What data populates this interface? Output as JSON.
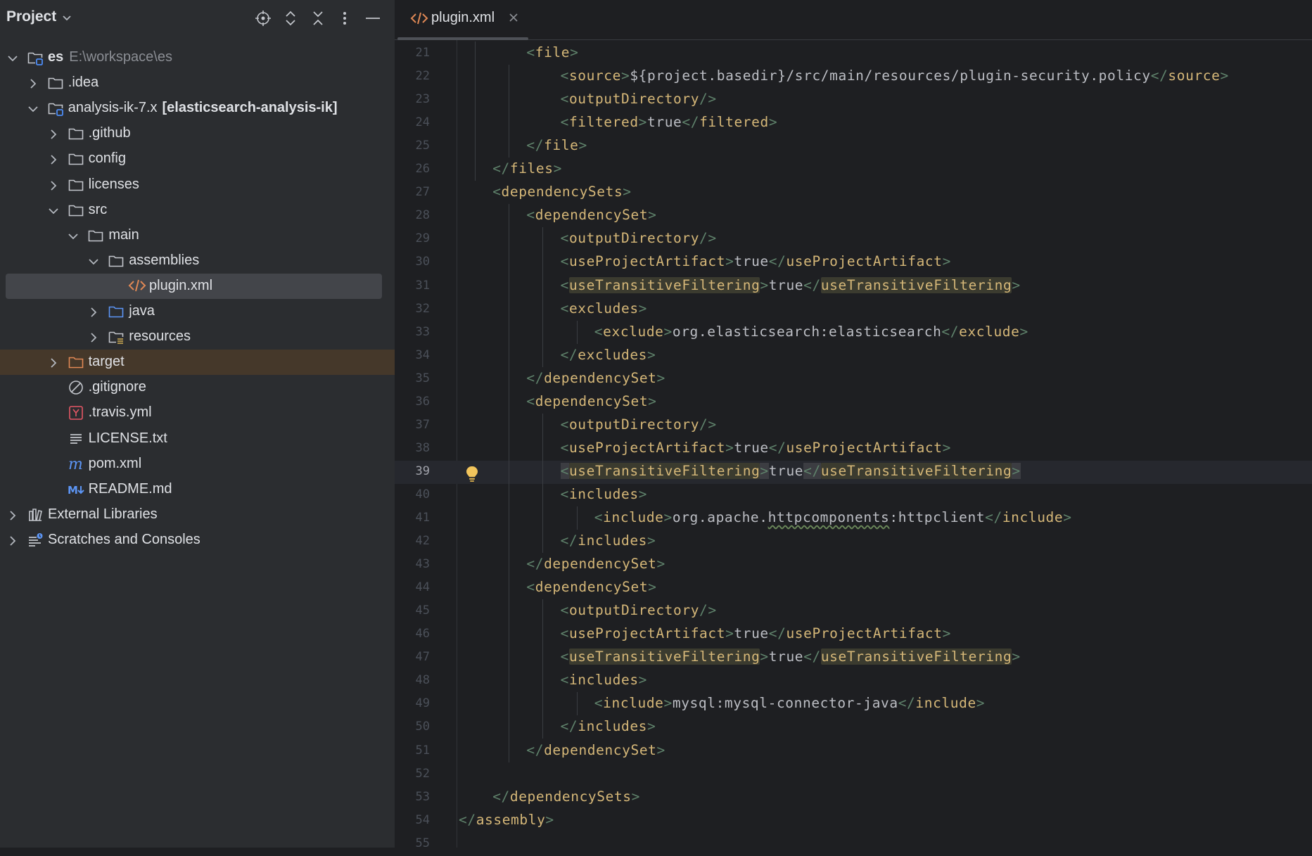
{
  "project_panel": {
    "title": "Project",
    "tree": [
      {
        "label": "es",
        "bold": true,
        "path": "E:\\workspace\\es",
        "icon": "module-folder-icon",
        "arrow": "expanded",
        "depth": 0
      },
      {
        "label": ".idea",
        "icon": "folder-icon",
        "arrow": "collapsed",
        "depth": 1
      },
      {
        "label": "analysis-ik-7.x",
        "suffix": "[elasticsearch-analysis-ik]",
        "icon": "module-folder-icon",
        "arrow": "expanded",
        "depth": 1
      },
      {
        "label": ".github",
        "icon": "folder-icon",
        "arrow": "collapsed",
        "depth": 2
      },
      {
        "label": "config",
        "icon": "folder-icon",
        "arrow": "collapsed",
        "depth": 2
      },
      {
        "label": "licenses",
        "icon": "folder-icon",
        "arrow": "collapsed",
        "depth": 2
      },
      {
        "label": "src",
        "icon": "folder-icon",
        "arrow": "expanded",
        "depth": 2
      },
      {
        "label": "main",
        "icon": "folder-icon",
        "arrow": "expanded",
        "depth": 3
      },
      {
        "label": "assemblies",
        "icon": "folder-icon",
        "arrow": "expanded",
        "depth": 4
      },
      {
        "label": "plugin.xml",
        "icon": "xml-file-icon",
        "arrow": "none",
        "depth": 5,
        "selected": true
      },
      {
        "label": "java",
        "icon": "source-folder-icon",
        "arrow": "collapsed",
        "depth": 4
      },
      {
        "label": "resources",
        "icon": "resources-folder-icon",
        "arrow": "collapsed",
        "depth": 4
      },
      {
        "label": "target",
        "icon": "excluded-folder-icon",
        "arrow": "collapsed",
        "depth": 2,
        "excluded": true
      },
      {
        "label": ".gitignore",
        "icon": "ignore-file-icon",
        "arrow": "none",
        "depth": 2
      },
      {
        "label": ".travis.yml",
        "icon": "yaml-file-icon",
        "arrow": "none",
        "depth": 2
      },
      {
        "label": "LICENSE.txt",
        "icon": "text-file-icon",
        "arrow": "none",
        "depth": 2
      },
      {
        "label": "pom.xml",
        "icon": "maven-file-icon",
        "arrow": "none",
        "depth": 2
      },
      {
        "label": "README.md",
        "icon": "markdown-file-icon",
        "arrow": "none",
        "depth": 2
      },
      {
        "label": "External Libraries",
        "icon": "libraries-icon",
        "arrow": "collapsed",
        "depth": 0
      },
      {
        "label": "Scratches and Consoles",
        "icon": "scratches-icon",
        "arrow": "collapsed",
        "depth": 0
      }
    ]
  },
  "editor": {
    "tab_label": "plugin.xml",
    "current_line": "39",
    "lines": [
      {
        "n": "21",
        "indent": 2,
        "parts": [
          [
            "br",
            "<"
          ],
          [
            "tag",
            "file"
          ],
          [
            "br",
            ">"
          ]
        ]
      },
      {
        "n": "22",
        "indent": 3,
        "parts": [
          [
            "br",
            "<"
          ],
          [
            "tag",
            "source"
          ],
          [
            "br",
            ">"
          ],
          [
            "txt",
            "${project.basedir}/src/main/resources/plugin-security.policy"
          ],
          [
            "br",
            "</"
          ],
          [
            "tag",
            "source"
          ],
          [
            "br",
            ">"
          ]
        ]
      },
      {
        "n": "23",
        "indent": 3,
        "parts": [
          [
            "br",
            "<"
          ],
          [
            "tag",
            "outputDirectory"
          ],
          [
            "br",
            "/>"
          ]
        ]
      },
      {
        "n": "24",
        "indent": 3,
        "parts": [
          [
            "br",
            "<"
          ],
          [
            "tag",
            "filtered"
          ],
          [
            "br",
            ">"
          ],
          [
            "txt",
            "true"
          ],
          [
            "br",
            "</"
          ],
          [
            "tag",
            "filtered"
          ],
          [
            "br",
            ">"
          ]
        ]
      },
      {
        "n": "25",
        "indent": 2,
        "parts": [
          [
            "br",
            "</"
          ],
          [
            "tag",
            "file"
          ],
          [
            "br",
            ">"
          ]
        ]
      },
      {
        "n": "26",
        "indent": 1,
        "parts": [
          [
            "br",
            "</"
          ],
          [
            "tag",
            "files"
          ],
          [
            "br",
            ">"
          ]
        ]
      },
      {
        "n": "27",
        "indent": 1,
        "parts": [
          [
            "br",
            "<"
          ],
          [
            "tag",
            "dependencySets"
          ],
          [
            "br",
            ">"
          ]
        ]
      },
      {
        "n": "28",
        "indent": 2,
        "parts": [
          [
            "br",
            "<"
          ],
          [
            "tag",
            "dependencySet"
          ],
          [
            "br",
            ">"
          ]
        ]
      },
      {
        "n": "29",
        "indent": 3,
        "parts": [
          [
            "br",
            "<"
          ],
          [
            "tag",
            "outputDirectory"
          ],
          [
            "br",
            "/>"
          ]
        ]
      },
      {
        "n": "30",
        "indent": 3,
        "parts": [
          [
            "br",
            "<"
          ],
          [
            "tag",
            "useProjectArtifact"
          ],
          [
            "br",
            ">"
          ],
          [
            "txt",
            "true"
          ],
          [
            "br",
            "</"
          ],
          [
            "tag",
            "useProjectArtifact"
          ],
          [
            "br",
            ">"
          ]
        ]
      },
      {
        "n": "31",
        "indent": 3,
        "parts": [
          [
            "br",
            "<"
          ],
          [
            "tagh",
            "useTransitiveFiltering"
          ],
          [
            "br",
            ">"
          ],
          [
            "txt",
            "true"
          ],
          [
            "br",
            "</"
          ],
          [
            "tagh",
            "useTransitiveFiltering"
          ],
          [
            "br",
            ">"
          ]
        ]
      },
      {
        "n": "32",
        "indent": 3,
        "parts": [
          [
            "br",
            "<"
          ],
          [
            "tag",
            "excludes"
          ],
          [
            "br",
            ">"
          ]
        ]
      },
      {
        "n": "33",
        "indent": 4,
        "parts": [
          [
            "br",
            "<"
          ],
          [
            "tag",
            "exclude"
          ],
          [
            "br",
            ">"
          ],
          [
            "txt",
            "org.elasticsearch:elasticsearch"
          ],
          [
            "br",
            "</"
          ],
          [
            "tag",
            "exclude"
          ],
          [
            "br",
            ">"
          ]
        ]
      },
      {
        "n": "34",
        "indent": 3,
        "parts": [
          [
            "br",
            "</"
          ],
          [
            "tag",
            "excludes"
          ],
          [
            "br",
            ">"
          ]
        ]
      },
      {
        "n": "35",
        "indent": 2,
        "parts": [
          [
            "br",
            "</"
          ],
          [
            "tag",
            "dependencySet"
          ],
          [
            "br",
            ">"
          ]
        ]
      },
      {
        "n": "36",
        "indent": 2,
        "parts": [
          [
            "br",
            "<"
          ],
          [
            "tag",
            "dependencySet"
          ],
          [
            "br",
            ">"
          ]
        ]
      },
      {
        "n": "37",
        "indent": 3,
        "parts": [
          [
            "br",
            "<"
          ],
          [
            "tag",
            "outputDirectory"
          ],
          [
            "br",
            "/>"
          ]
        ]
      },
      {
        "n": "38",
        "indent": 3,
        "parts": [
          [
            "br",
            "<"
          ],
          [
            "tag",
            "useProjectArtifact"
          ],
          [
            "br",
            ">"
          ],
          [
            "txt",
            "true"
          ],
          [
            "br",
            "</"
          ],
          [
            "tag",
            "useProjectArtifact"
          ],
          [
            "br",
            ">"
          ]
        ]
      },
      {
        "n": "39",
        "indent": 3,
        "parts": [
          [
            "brh",
            "<"
          ],
          [
            "tagh",
            "useTransitiveFiltering"
          ],
          [
            "brh",
            ">"
          ],
          [
            "txt",
            "true"
          ],
          [
            "brh",
            "</"
          ],
          [
            "tagh",
            "useTransitiveFiltering"
          ],
          [
            "brh",
            ">"
          ]
        ]
      },
      {
        "n": "40",
        "indent": 3,
        "parts": [
          [
            "br",
            "<"
          ],
          [
            "tag",
            "includes"
          ],
          [
            "br",
            ">"
          ]
        ]
      },
      {
        "n": "41",
        "indent": 4,
        "parts": [
          [
            "br",
            "<"
          ],
          [
            "tag",
            "include"
          ],
          [
            "br",
            ">"
          ],
          [
            "txt",
            "org.apache."
          ],
          [
            "txtsq",
            "httpcomponents"
          ],
          [
            "txt",
            ":httpclient"
          ],
          [
            "br",
            "</"
          ],
          [
            "tag",
            "include"
          ],
          [
            "br",
            ">"
          ]
        ]
      },
      {
        "n": "42",
        "indent": 3,
        "parts": [
          [
            "br",
            "</"
          ],
          [
            "tag",
            "includes"
          ],
          [
            "br",
            ">"
          ]
        ]
      },
      {
        "n": "43",
        "indent": 2,
        "parts": [
          [
            "br",
            "</"
          ],
          [
            "tag",
            "dependencySet"
          ],
          [
            "br",
            ">"
          ]
        ]
      },
      {
        "n": "44",
        "indent": 2,
        "parts": [
          [
            "br",
            "<"
          ],
          [
            "tag",
            "dependencySet"
          ],
          [
            "br",
            ">"
          ]
        ]
      },
      {
        "n": "45",
        "indent": 3,
        "parts": [
          [
            "br",
            "<"
          ],
          [
            "tag",
            "outputDirectory"
          ],
          [
            "br",
            "/>"
          ]
        ]
      },
      {
        "n": "46",
        "indent": 3,
        "parts": [
          [
            "br",
            "<"
          ],
          [
            "tag",
            "useProjectArtifact"
          ],
          [
            "br",
            ">"
          ],
          [
            "txt",
            "true"
          ],
          [
            "br",
            "</"
          ],
          [
            "tag",
            "useProjectArtifact"
          ],
          [
            "br",
            ">"
          ]
        ]
      },
      {
        "n": "47",
        "indent": 3,
        "parts": [
          [
            "br",
            "<"
          ],
          [
            "tagh",
            "useTransitiveFiltering"
          ],
          [
            "br",
            ">"
          ],
          [
            "txt",
            "true"
          ],
          [
            "br",
            "</"
          ],
          [
            "tagh",
            "useTransitiveFiltering"
          ],
          [
            "br",
            ">"
          ]
        ]
      },
      {
        "n": "48",
        "indent": 3,
        "parts": [
          [
            "br",
            "<"
          ],
          [
            "tag",
            "includes"
          ],
          [
            "br",
            ">"
          ]
        ]
      },
      {
        "n": "49",
        "indent": 4,
        "parts": [
          [
            "br",
            "<"
          ],
          [
            "tag",
            "include"
          ],
          [
            "br",
            ">"
          ],
          [
            "txt",
            "mysql:mysql-connector-java"
          ],
          [
            "br",
            "</"
          ],
          [
            "tag",
            "include"
          ],
          [
            "br",
            ">"
          ]
        ]
      },
      {
        "n": "50",
        "indent": 3,
        "parts": [
          [
            "br",
            "</"
          ],
          [
            "tag",
            "includes"
          ],
          [
            "br",
            ">"
          ]
        ]
      },
      {
        "n": "51",
        "indent": 2,
        "parts": [
          [
            "br",
            "</"
          ],
          [
            "tag",
            "dependencySet"
          ],
          [
            "br",
            ">"
          ]
        ]
      },
      {
        "n": "52",
        "indent": 0,
        "parts": []
      },
      {
        "n": "53",
        "indent": 1,
        "parts": [
          [
            "br",
            "</"
          ],
          [
            "tag",
            "dependencySets"
          ],
          [
            "br",
            ">"
          ]
        ]
      },
      {
        "n": "54",
        "indent": 0,
        "parts": [
          [
            "br",
            "</"
          ],
          [
            "tag",
            "assembly"
          ],
          [
            "br",
            ">"
          ]
        ]
      },
      {
        "n": "55",
        "indent": 0,
        "parts": []
      }
    ]
  },
  "colors": {
    "panel_bg": "#2b2d30",
    "editor_bg": "#1e1f22",
    "tag": "#d5b778",
    "bracket": "#5f826b",
    "text": "#bcbec4",
    "selection": "#43454a",
    "excluded_row": "#45382a"
  }
}
